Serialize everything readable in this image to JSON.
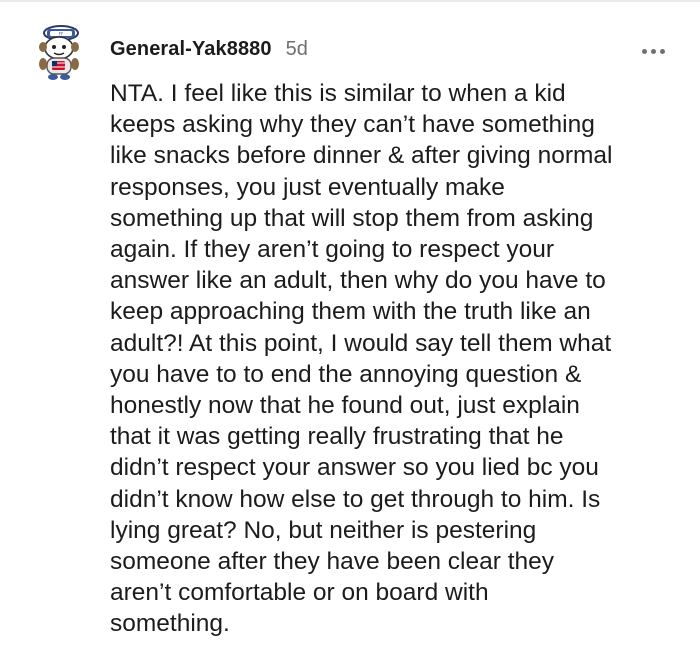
{
  "comment": {
    "username": "General-Yak8880",
    "timestamp": "5d",
    "more_icon": "more-horizontal-icon",
    "avatar_icon": "snoo-avatar-icon",
    "body_lines": "NTA. I feel like this is similar to when a kid\nkeeps asking why they can’t have something\nlike snacks before dinner & after giving normal\nresponses, you just eventually make\nsomething up that will stop them from asking\nagain. If they aren’t going to respect your\nanswer like an adult, then why do you have to\nkeep approaching them with the truth like an\nadult?! At this point, I would say tell them what\nyou have to to end the annoying question &\nhonestly now that he found out, just explain\nthat it was getting really frustrating that he\ndidn’t respect your answer so you lied bc you\ndidn’t know how else to get through to him. Is\nlying great? No, but neither is pestering\nsomeone after they have been clear they\naren’t comfortable or on board with\nsomething."
  },
  "colors": {
    "text": "#1c1c1c",
    "meta": "#6f6f6f",
    "divider": "#eaeaea"
  }
}
